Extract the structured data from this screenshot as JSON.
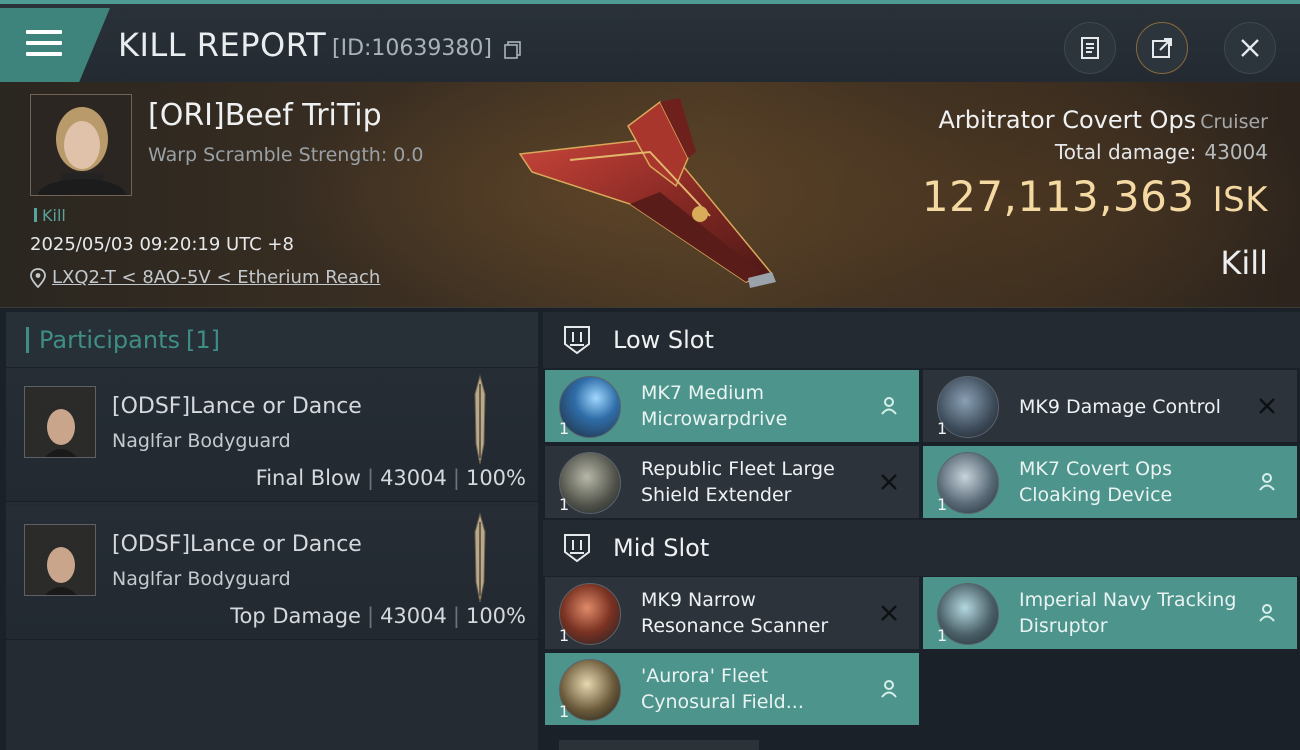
{
  "header": {
    "title": "KILL REPORT",
    "report_id": "[ID:10639380]",
    "icons": [
      "clipboard-icon",
      "share-icon",
      "close-icon"
    ]
  },
  "victim": {
    "name": "[ORI]Beef TriTip",
    "warp_scramble": "Warp Scramble Strength: 0.0",
    "kill_tag": "Kill",
    "datetime": "2025/05/03 09:20:19 UTC +8",
    "location": "LXQ2-T < 8AO-5V < Etherium Reach"
  },
  "ship": {
    "name": "Arbitrator Covert Ops",
    "class": "Cruiser",
    "total_damage_label": "Total damage:",
    "total_damage": "43004",
    "isk_value": "127,113,363",
    "isk_unit": "ISK",
    "result": "Kill"
  },
  "participants": {
    "title": "Participants",
    "count": "[1]",
    "items": [
      {
        "name": "[ODSF]Lance or Dance",
        "ship": "Naglfar Bodyguard",
        "role": "Final Blow",
        "damage": "43004",
        "percent": "100%"
      },
      {
        "name": "[ODSF]Lance or Dance",
        "ship": "Naglfar Bodyguard",
        "role": "Top Damage",
        "damage": "43004",
        "percent": "100%"
      }
    ]
  },
  "slots": {
    "low": {
      "label": "Low Slot",
      "modules": [
        {
          "name": "MK7 Medium Microwarpdrive",
          "qty": "1",
          "status": "dropped",
          "icon": "microwarpdrive-icon"
        },
        {
          "name": "MK9 Damage Control",
          "qty": "1",
          "status": "destroyed",
          "icon": "damage-control-icon"
        },
        {
          "name": "Republic Fleet Large Shield Extender",
          "qty": "1",
          "status": "destroyed",
          "icon": "shield-extender-icon"
        },
        {
          "name": "MK7 Covert Ops Cloaking Device",
          "qty": "1",
          "status": "dropped",
          "icon": "cloaking-device-icon"
        }
      ]
    },
    "mid": {
      "label": "Mid Slot",
      "modules": [
        {
          "name": "MK9 Narrow Resonance Scanner",
          "qty": "1",
          "status": "destroyed",
          "icon": "scanner-icon"
        },
        {
          "name": "Imperial Navy Tracking Disruptor",
          "qty": "1",
          "status": "dropped",
          "icon": "tracking-disruptor-icon"
        },
        {
          "name": "'Aurora' Fleet Cynosural Field...",
          "qty": "1",
          "status": "dropped",
          "icon": "cynosural-field-icon"
        }
      ]
    }
  },
  "colors": {
    "accent_teal": "#4d958c",
    "isk_gold": "#f4d9a3",
    "panel": "#242b33"
  }
}
